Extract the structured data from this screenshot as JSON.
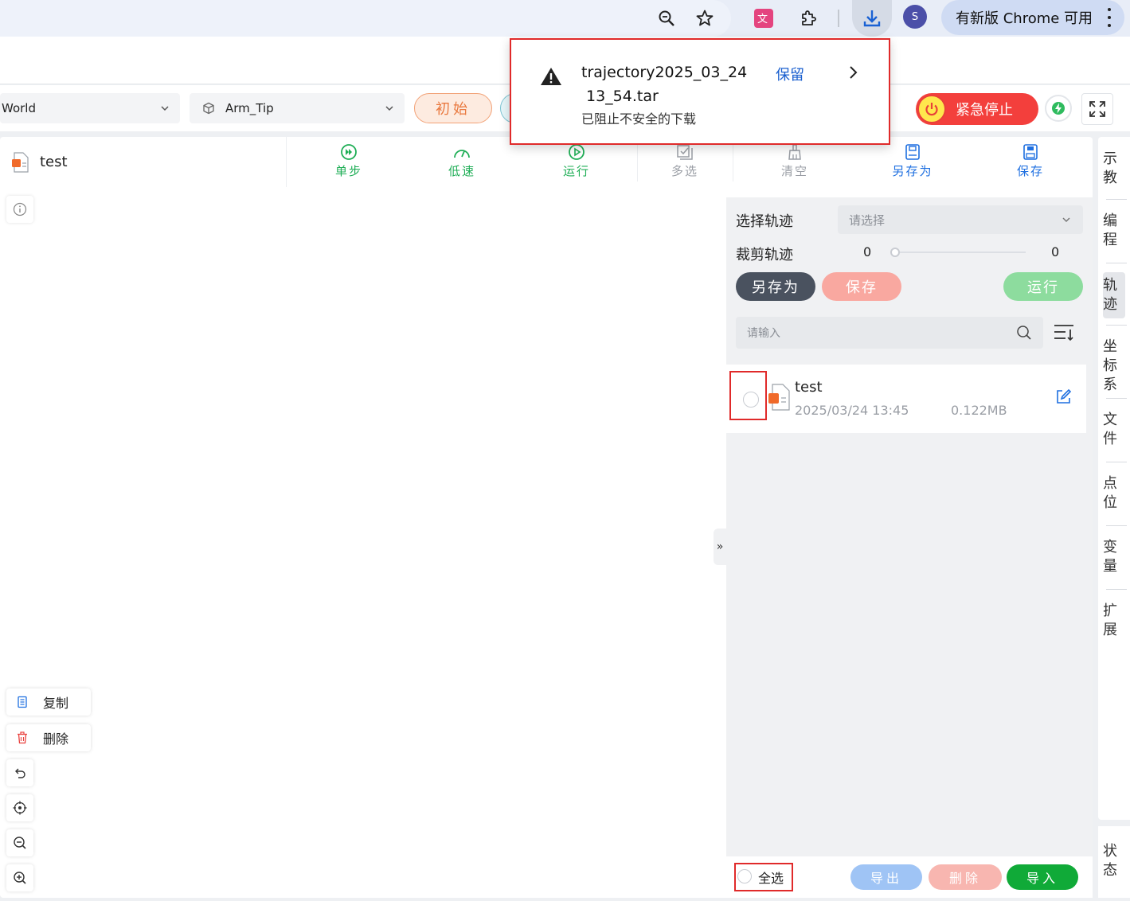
{
  "chrome": {
    "avatar_letter": "S",
    "update_label": "有新版 Chrome 可用"
  },
  "download_popup": {
    "filename_line1": "trajectory2025_03_24",
    "filename_line2": "13_54.tar",
    "status": "已阻止不安全的下载",
    "keep_label": "保留"
  },
  "controls": {
    "frame_select": "World",
    "tool_select": "Arm_Tip",
    "init_label": "初始",
    "estop_label": "紧急停止"
  },
  "file": {
    "name": "test"
  },
  "toolbar": {
    "step": "单步",
    "slow": "低速",
    "run": "运行",
    "multi": "多选",
    "clear": "清空",
    "save_as": "另存为",
    "save": "保存"
  },
  "float_actions": {
    "copy": "复制",
    "delete": "删除"
  },
  "trajectory": {
    "select_label": "选择轨迹",
    "select_placeholder": "请选择",
    "clip_label": "裁剪轨迹",
    "clip_start": "0",
    "clip_end": "0",
    "save_as": "另存为",
    "save": "保存",
    "run": "运行",
    "search_placeholder": "请输入",
    "items": [
      {
        "name": "test",
        "date": "2025/03/24 13:45",
        "size": "0.122MB"
      }
    ],
    "select_all": "全选",
    "export": "导出",
    "delete": "删除",
    "import": "导入"
  },
  "side_nav": [
    {
      "label": "示教",
      "active": false
    },
    {
      "label": "编程",
      "active": false
    },
    {
      "label": "轨迹",
      "active": true
    },
    {
      "label": "坐标系",
      "active": false
    },
    {
      "label": "文件",
      "active": false
    },
    {
      "label": "点位",
      "active": false
    },
    {
      "label": "变量",
      "active": false
    },
    {
      "label": "扩展",
      "active": false
    }
  ],
  "side_status": "状态",
  "colors": {
    "green": "#1fae56",
    "blue": "#1e6fe0",
    "estop_red": "#f33f3c",
    "highlight_red": "#e02a2a"
  }
}
